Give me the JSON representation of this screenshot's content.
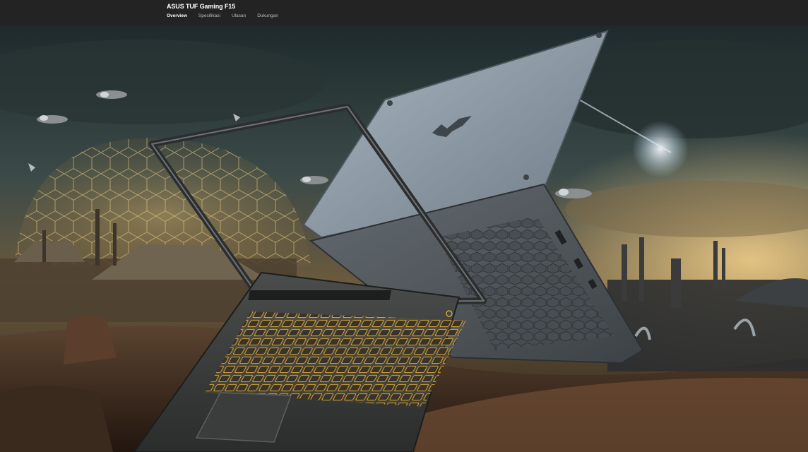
{
  "header": {
    "product_title": "ASUS TUF Gaming F15",
    "tabs": [
      {
        "label": "Overview",
        "active": true
      },
      {
        "label": "Spesifikasi",
        "active": false
      },
      {
        "label": "Ulasan",
        "active": false
      },
      {
        "label": "Dukungan",
        "active": false
      }
    ]
  },
  "hero": {
    "logo_icon": "tuf-logo-icon"
  },
  "colors": {
    "topbar": "#232323",
    "keyboard_backlight": "#f2b63a",
    "laptop_lid": "#8d9aa6"
  }
}
